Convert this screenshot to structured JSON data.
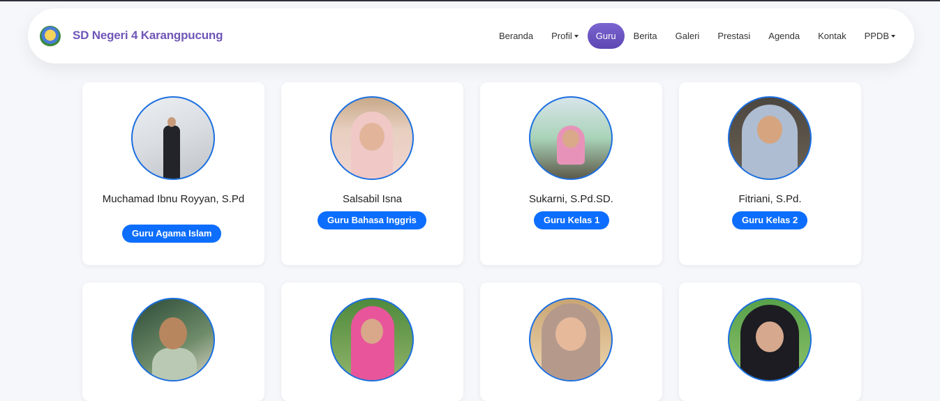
{
  "site": {
    "name": "SD Negeri 4 Karangpucung"
  },
  "nav": {
    "items": [
      "Beranda",
      "Profil",
      "Guru",
      "Berita",
      "Galeri",
      "Prestasi",
      "Agenda",
      "Kontak",
      "PPDB"
    ],
    "active": "Guru"
  },
  "teachers": [
    {
      "name": "Muchamad Ibnu Royyan, S.Pd",
      "role": "Guru Agama Islam"
    },
    {
      "name": "Salsabil Isna",
      "role": "Guru Bahasa Inggris"
    },
    {
      "name": "Sukarni, S.Pd.SD.",
      "role": "Guru Kelas 1"
    },
    {
      "name": "Fitriani, S.Pd.",
      "role": "Guru Kelas 2"
    }
  ],
  "colors": {
    "brand": "#6f56b8",
    "accent": "#0d6efd",
    "nav_active": "#6a52c2"
  }
}
